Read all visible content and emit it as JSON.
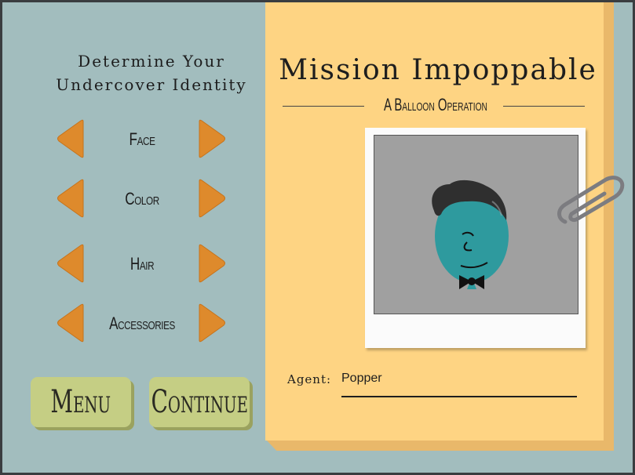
{
  "left_panel": {
    "title_line1": "Determine Your",
    "title_line2": "Undercover Identity",
    "options": [
      {
        "label": "Face"
      },
      {
        "label": "Color"
      },
      {
        "label": "Hair"
      },
      {
        "label": "Accessories"
      }
    ],
    "menu_label": "Menu",
    "continue_label": "Continue"
  },
  "folder": {
    "title": "Mission Impoppable",
    "subtitle": "A Balloon Operation",
    "agent_label": "Agent:",
    "agent_name": "Popper"
  },
  "colors": {
    "background": "#a2bdbe",
    "folder": "#fed483",
    "arrow": "#de8a2c",
    "button": "#c5ce84",
    "balloon": "#2e9a9e"
  },
  "icons": {
    "prev": "left-triangle-icon",
    "next": "right-triangle-icon",
    "clip": "paperclip-icon"
  }
}
